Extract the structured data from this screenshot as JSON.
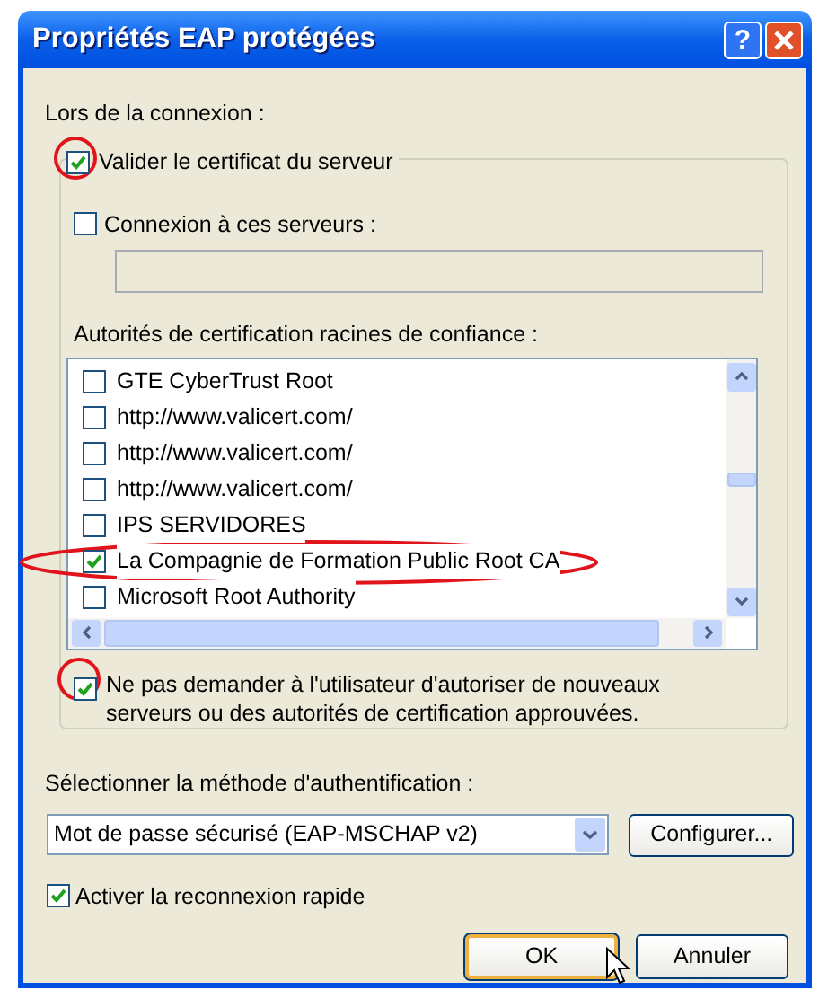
{
  "window": {
    "title": "Propriétés EAP protégées",
    "help_button": "?"
  },
  "connection_label": "Lors de la connexion :",
  "validate_server": {
    "label": "Valider le certificat du serveur",
    "checked": true
  },
  "connect_servers": {
    "label": "Connexion à ces serveurs :",
    "checked": false
  },
  "authorities_label": "Autorités de certification racines de confiance :",
  "authorities": [
    {
      "name": "GTE CyberTrust Root",
      "checked": false
    },
    {
      "name": "http://www.valicert.com/",
      "checked": false
    },
    {
      "name": "http://www.valicert.com/",
      "checked": false
    },
    {
      "name": "http://www.valicert.com/",
      "checked": false
    },
    {
      "name": "IPS SERVIDORES",
      "checked": false
    },
    {
      "name": "La Compagnie de Formation Public Root CA",
      "checked": true
    },
    {
      "name": "Microsoft Root Authority",
      "checked": false
    }
  ],
  "no_prompt": {
    "label": "Ne pas demander à l'utilisateur d'autoriser de nouveaux serveurs ou des autorités de certification approuvées.",
    "checked": true
  },
  "method_label": "Sélectionner la méthode d'authentification :",
  "method": {
    "value": "Mot de passe sécurisé (EAP-MSCHAP v2)"
  },
  "configure_button": "Configurer...",
  "fast_reconnect": {
    "label": "Activer la reconnexion rapide",
    "checked": true
  },
  "buttons": [
    {
      "label": "OK",
      "kind": "default"
    },
    {
      "label": "Annuler",
      "kind": "normal"
    }
  ]
}
